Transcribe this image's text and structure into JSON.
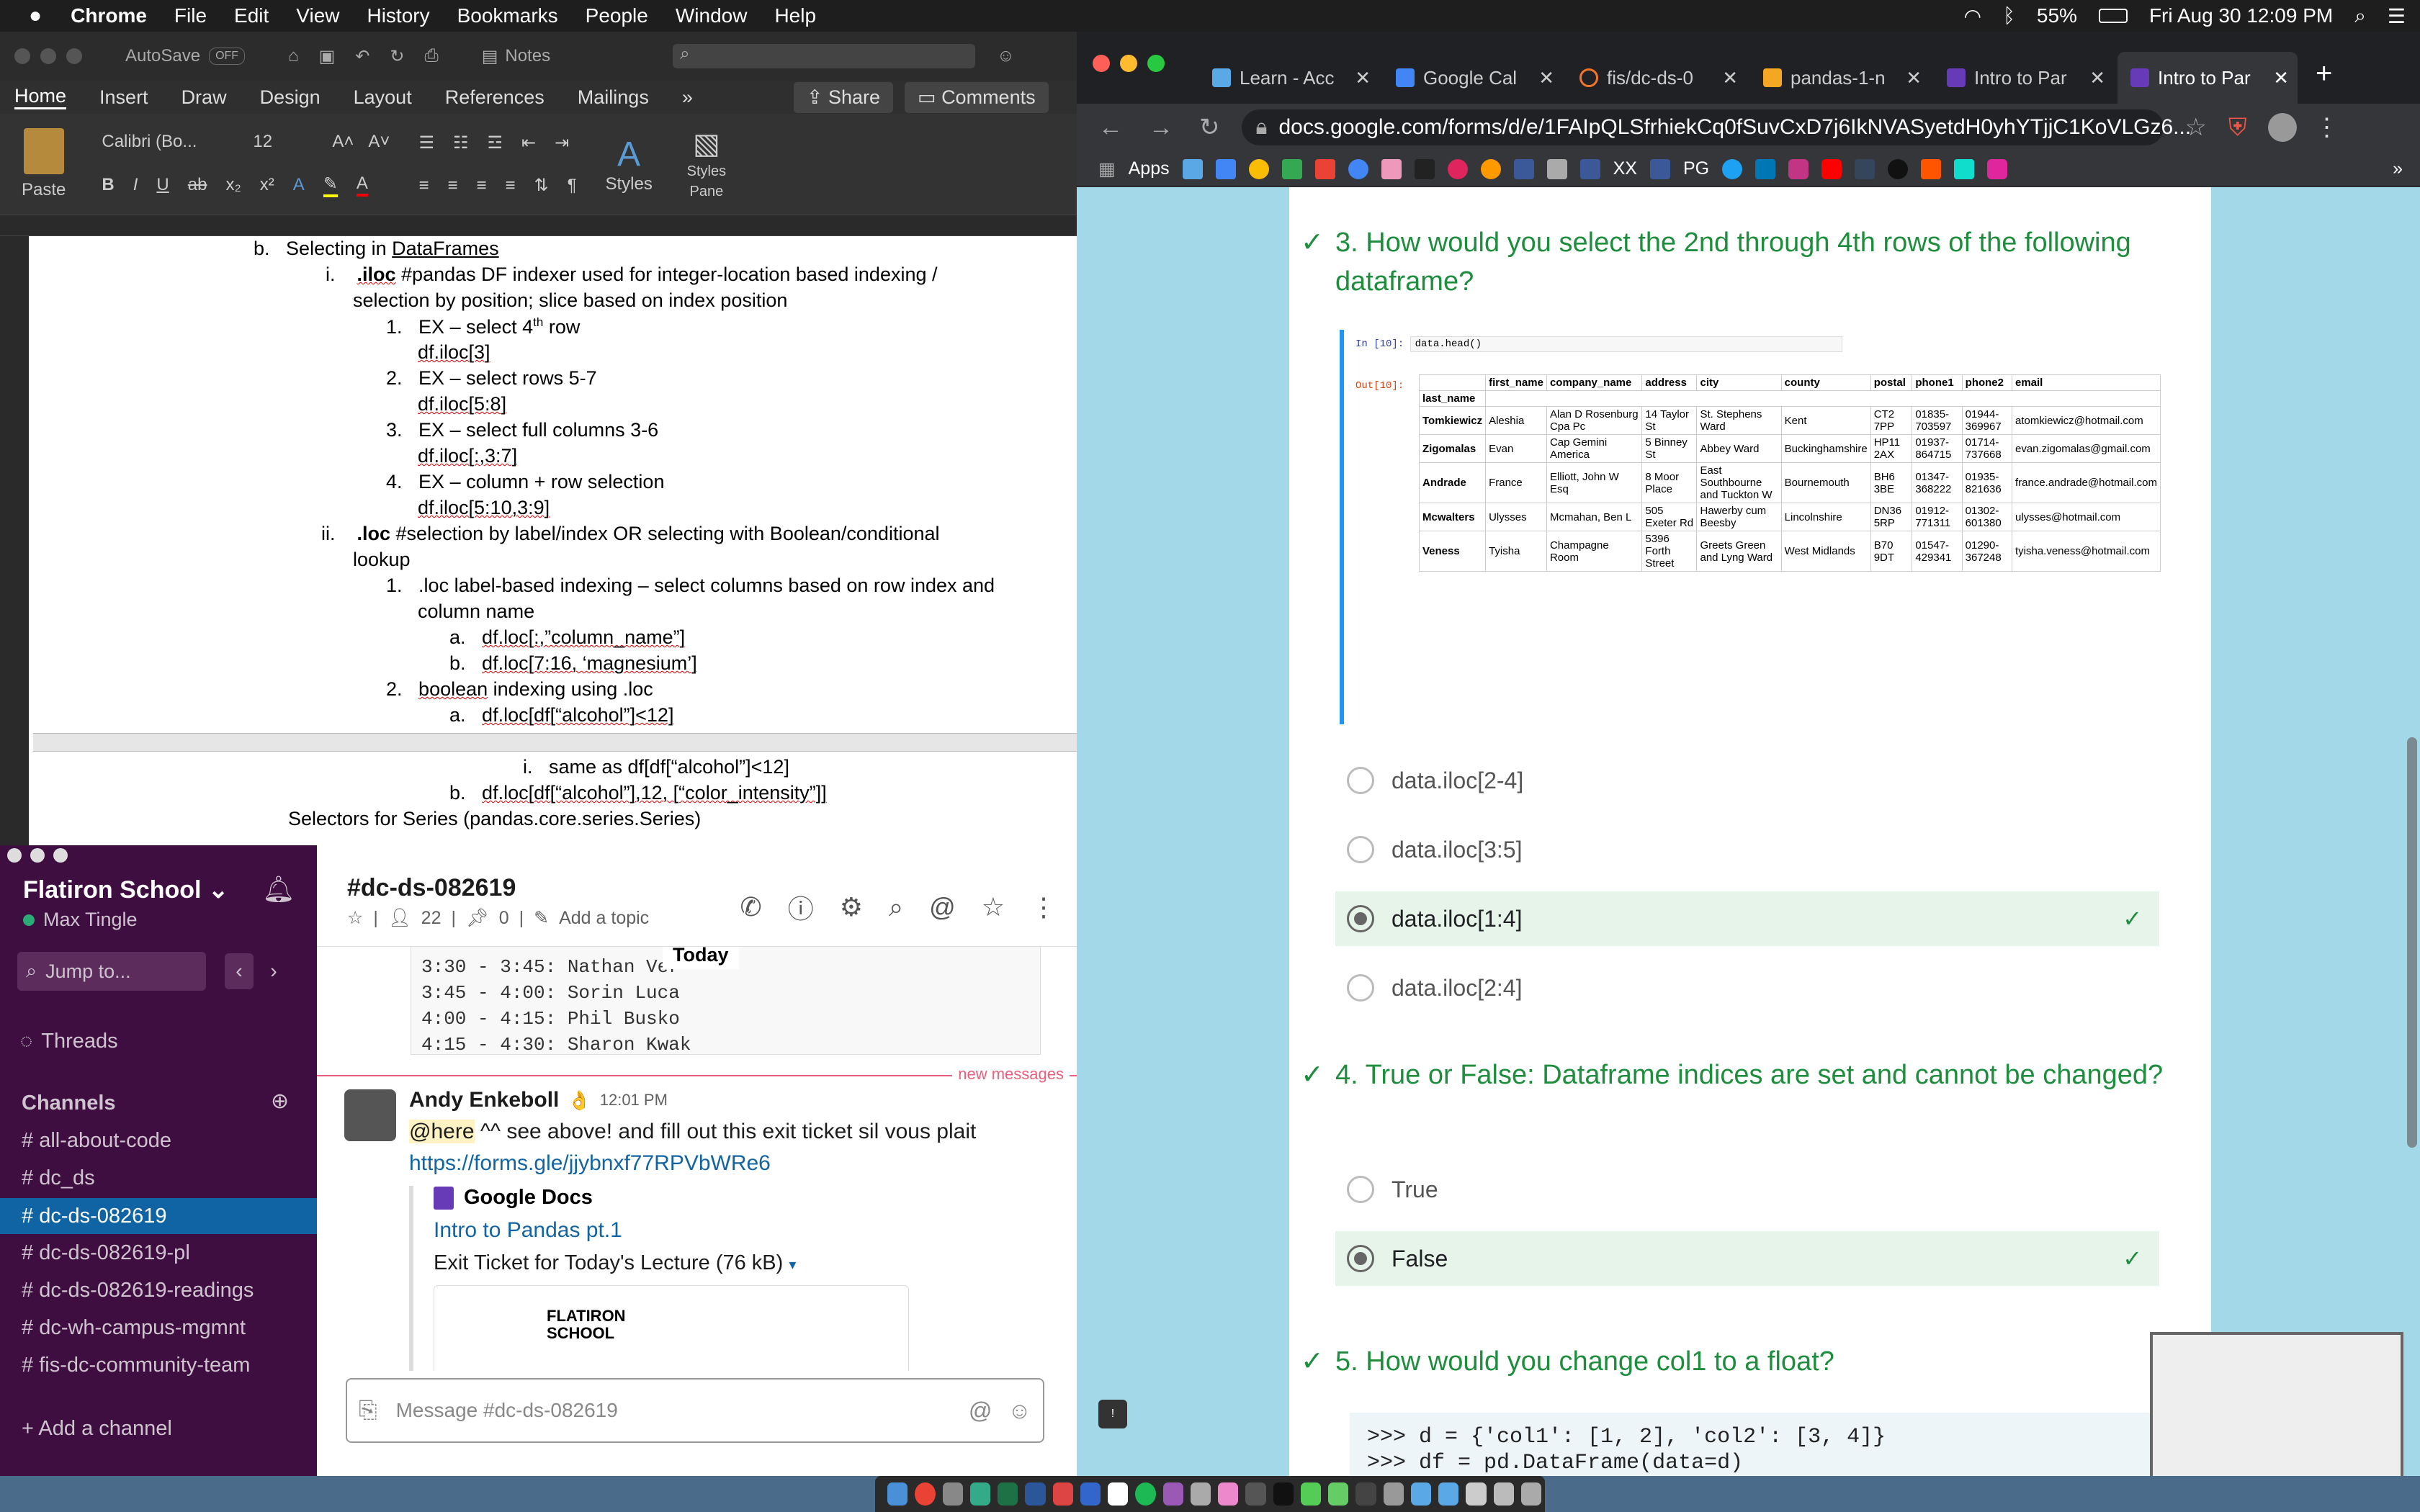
{
  "menubar": {
    "app": "Chrome",
    "items": [
      "File",
      "Edit",
      "View",
      "History",
      "Bookmarks",
      "People",
      "Window",
      "Help"
    ],
    "battery": "55%",
    "datetime": "Fri Aug 30  12:09 PM"
  },
  "word": {
    "autosave": "AutoSave",
    "autosave_state": "OFF",
    "doc_title": "Notes",
    "tabs": [
      "Home",
      "Insert",
      "Draw",
      "Design",
      "Layout",
      "References",
      "Mailings"
    ],
    "share": "Share",
    "comments": "Comments",
    "paste": "Paste",
    "font_name": "Calibri (Bo...",
    "font_size": "12",
    "styles": "Styles",
    "styles_pane": "Styles Pane",
    "lines": {
      "l1_num": "b.",
      "l1_text": "Selecting in ",
      "l1_u": "DataFrames",
      "l2_num": "i.",
      "l2_b": ".iloc",
      "l2_t": " #pandas DF indexer used for integer-location based indexing /",
      "l3": "selection by position; slice based on index position",
      "l4_num": "1.",
      "l4_t": "EX – select 4",
      "l4_sup": "th",
      "l4_t2": " row",
      "l5": "df.iloc[3]",
      "l6_num": "2.",
      "l6_t": "EX – select rows 5-7",
      "l7": "df.iloc[5:8]",
      "l8_num": "3.",
      "l8_t": "EX – select full columns 3-6",
      "l9": "df.iloc[:,3:7]",
      "l10_num": "4.",
      "l10_t": "EX – column + row selection",
      "l11": "df.iloc[5:10,3:9]",
      "l12_num": "ii.",
      "l12_b": ".loc",
      "l12_t": " #selection by label/index OR selecting with Boolean/conditional",
      "l13": "lookup",
      "l14_num": "1.",
      "l14_t": ".loc label-based indexing – select columns based on row index and",
      "l15": "column name",
      "l16_num": "a.",
      "l16": "df.loc[:,”column_name”]",
      "l17_num": "b.",
      "l17": "df.loc[7:16, ‘magnesium’]",
      "l18_num": "2.",
      "l18_u": "boolean",
      "l18_t": " indexing using .loc",
      "l19_num": "a.",
      "l19": "df.loc[df[“alcohol”]<12]",
      "l20_num": "i.",
      "l20": "same as df[df[“alcohol”]<12]",
      "l21_num": "b.",
      "l21": "df.loc[df[“alcohol”],12, [“color_intensity”]]",
      "l22": "Selectors for Series (pandas.core.series.Series)"
    }
  },
  "slack": {
    "workspace": "Flatiron School",
    "user": "Max Tingle",
    "jump": "Jump to...",
    "threads": "Threads",
    "channels_header": "Channels",
    "channels": [
      "all-about-code",
      "dc_ds",
      "dc-ds-082619",
      "dc-ds-082619-pl",
      "dc-ds-082619-readings",
      "dc-wh-campus-mgmnt",
      "fis-dc-community-team"
    ],
    "add_channel": "Add a channel",
    "channel_title": "#dc-ds-082619",
    "members": "22",
    "pins": "0",
    "add_topic": "Add a topic",
    "today": "Today",
    "schedule": [
      "3:30 - 3:45: Nathan Ver",
      "3:45 - 4:00: Sorin Luca",
      "4:00 - 4:15: Phil Busko",
      "4:15 - 4:30: Sharon Kwak"
    ],
    "new_messages": "new messages",
    "author": "Andy Enkeboll",
    "emoji": "👌",
    "time": "12:01 PM",
    "mention": "@here",
    "message": " ^^ see above! and fill out this exit ticket sil vous plait",
    "link": "https://forms.gle/jjybnxf77RPVbWRe6",
    "attach_source": "Google Docs",
    "attach_title": "Intro to Pandas pt.1",
    "attach_desc": "Exit Ticket for Today's Lecture (76 kB)",
    "logo_text": "FLATIRON SCHOOL",
    "input_placeholder": "Message #dc-ds-082619"
  },
  "chrome": {
    "tabs": [
      "Learn - Acc",
      "Google Cal",
      "fis/dc-ds-0",
      "pandas-1-n",
      "Intro to Par",
      "Intro to Par"
    ],
    "url": "docs.google.com/forms/d/e/1FAIpQLSfrhiekCq0fSuvCxD7j6IkNVASyetdH0yhYTjjC1KoVLGz6...",
    "bookmarks": [
      "Apps",
      "XX",
      "PG"
    ]
  },
  "form": {
    "q3": "3. How would you select the 2nd through 4th rows of the following dataframe?",
    "nb_in": "In [10]:",
    "nb_code": "data.head()",
    "nb_out": "Out[10]:",
    "df_cols": [
      "first_name",
      "company_name",
      "address",
      "city",
      "county",
      "postal",
      "phone1",
      "phone2",
      "email"
    ],
    "df_index": "last_name",
    "df_rows": [
      [
        "Tomkiewicz",
        "Aleshia",
        "Alan D Rosenburg Cpa Pc",
        "14 Taylor St",
        "St. Stephens Ward",
        "Kent",
        "CT2 7PP",
        "01835-703597",
        "01944-369967",
        "atomkiewicz@hotmail.com"
      ],
      [
        "Zigomalas",
        "Evan",
        "Cap Gemini America",
        "5 Binney St",
        "Abbey Ward",
        "Buckinghamshire",
        "HP11 2AX",
        "01937-864715",
        "01714-737668",
        "evan.zigomalas@gmail.com"
      ],
      [
        "Andrade",
        "France",
        "Elliott, John W Esq",
        "8 Moor Place",
        "East Southbourne and Tuckton W",
        "Bournemouth",
        "BH6 3BE",
        "01347-368222",
        "01935-821636",
        "france.andrade@hotmail.com"
      ],
      [
        "Mcwalters",
        "Ulysses",
        "Mcmahan, Ben L",
        "505 Exeter Rd",
        "Hawerby cum Beesby",
        "Lincolnshire",
        "DN36 5RP",
        "01912-771311",
        "01302-601380",
        "ulysses@hotmail.com"
      ],
      [
        "Veness",
        "Tyisha",
        "Champagne Room",
        "5396 Forth Street",
        "Greets Green and Lyng Ward",
        "West Midlands",
        "B70 9DT",
        "01547-429341",
        "01290-367248",
        "tyisha.veness@hotmail.com"
      ]
    ],
    "q3_opts": [
      "data.iloc[2-4]",
      "data.iloc[3:5]",
      "data.iloc[1:4]",
      "data.iloc[2:4]"
    ],
    "q4": "4. True or False: Dataframe indices are set and cannot be changed?",
    "q4_opts": [
      "True",
      "False"
    ],
    "q5": "5. How would you change col1 to a float?",
    "code1": ">>> d = {'col1': [1, 2], 'col2': [3, 4]}",
    "code2": ">>> df = pd.DataFrame(data=d)"
  }
}
